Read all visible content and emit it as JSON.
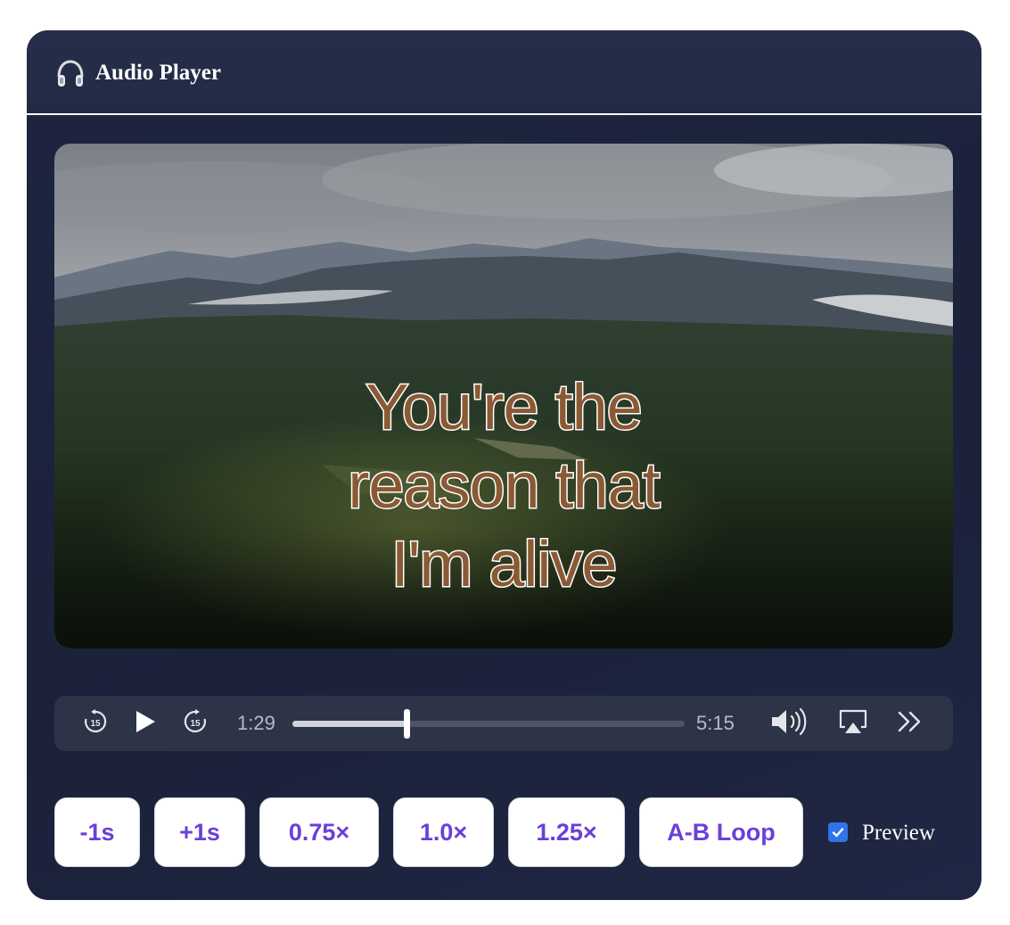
{
  "header": {
    "title": "Audio Player",
    "icon": "headphones-icon"
  },
  "video": {
    "lyric_lines": [
      "You're the",
      "reason that",
      "I'm alive"
    ],
    "lyric_fill_color": "#8a5a35",
    "lyric_stroke_color": "#ffffff"
  },
  "player": {
    "current_time": "1:29",
    "duration": "5:15",
    "progress_fraction": 0.29,
    "icons": {
      "skip_back": "rewind-15-icon",
      "play": "play-icon",
      "skip_forward": "forward-15-icon",
      "skip_seconds": "15",
      "volume": "volume-icon",
      "airplay": "airplay-icon",
      "more": "chevrons-right-icon"
    }
  },
  "buttons": [
    {
      "label": "-1s"
    },
    {
      "label": "+1s"
    },
    {
      "label": "0.75×"
    },
    {
      "label": "1.0×"
    },
    {
      "label": "1.25×"
    },
    {
      "label": "A-B Loop"
    }
  ],
  "preview": {
    "label": "Preview",
    "checked": true
  },
  "colors": {
    "accent": "#6a3fd9",
    "checkbox": "#2f74e8",
    "card_bg": "#1e2540"
  }
}
